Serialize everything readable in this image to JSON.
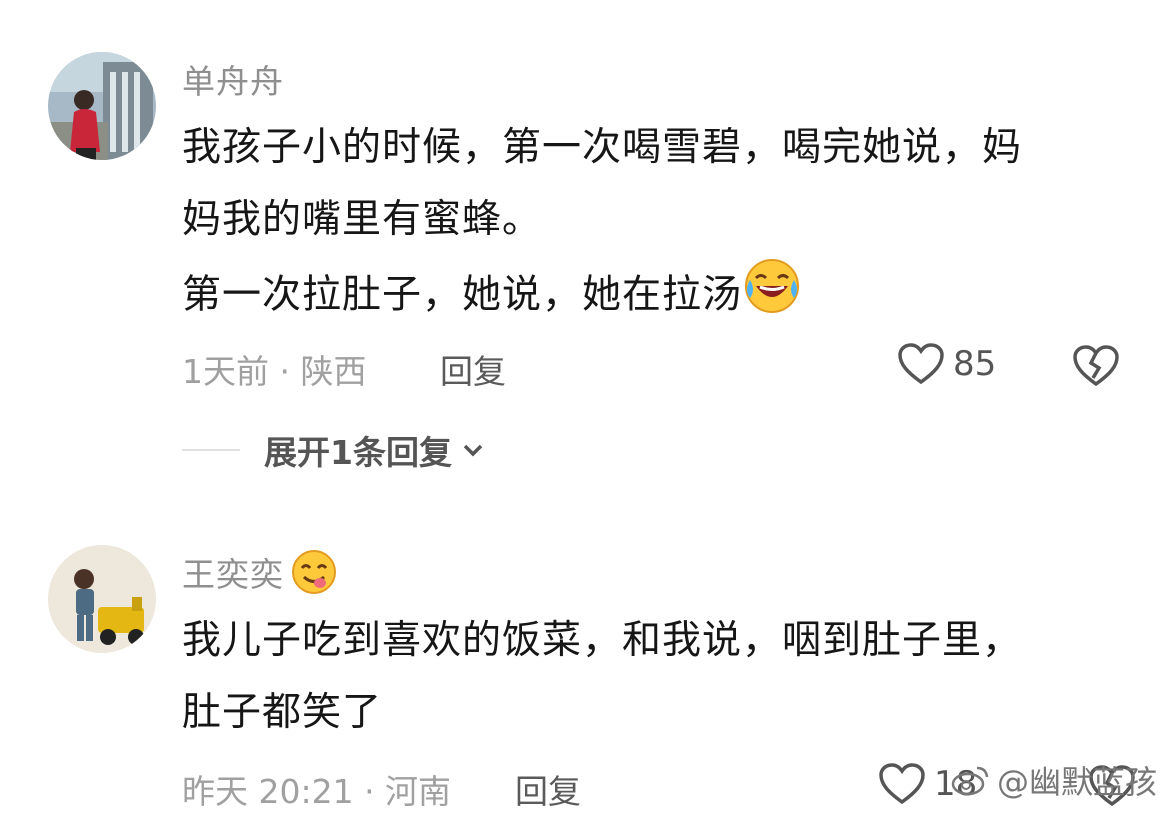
{
  "comments": [
    {
      "username": "单舟舟",
      "lines": [
        "我孩子小的时候，第一次喝雪碧，喝完她说，妈",
        "妈我的嘴里有蜜蜂。",
        "第一次拉肚子，她说，她在拉汤"
      ],
      "emoji_end": "laughing-crying-emoji",
      "meta": "1天前 · 陕西",
      "reply_label": "回复",
      "likes": "85",
      "expand_label": "展开1条回复"
    },
    {
      "username": "王奕奕",
      "username_emoji": "yum-face-emoji",
      "lines": [
        "我儿子吃到喜欢的饭菜，和我说，咽到肚子里，",
        "肚子都笑了"
      ],
      "meta": "昨天 20:21 · 河南",
      "reply_label": "回复",
      "likes": "18"
    }
  ],
  "watermark": "@幽默蓝孩",
  "colors": {
    "text": "#161616",
    "muted": "#a0a0a0",
    "username": "#8f8f8f"
  }
}
